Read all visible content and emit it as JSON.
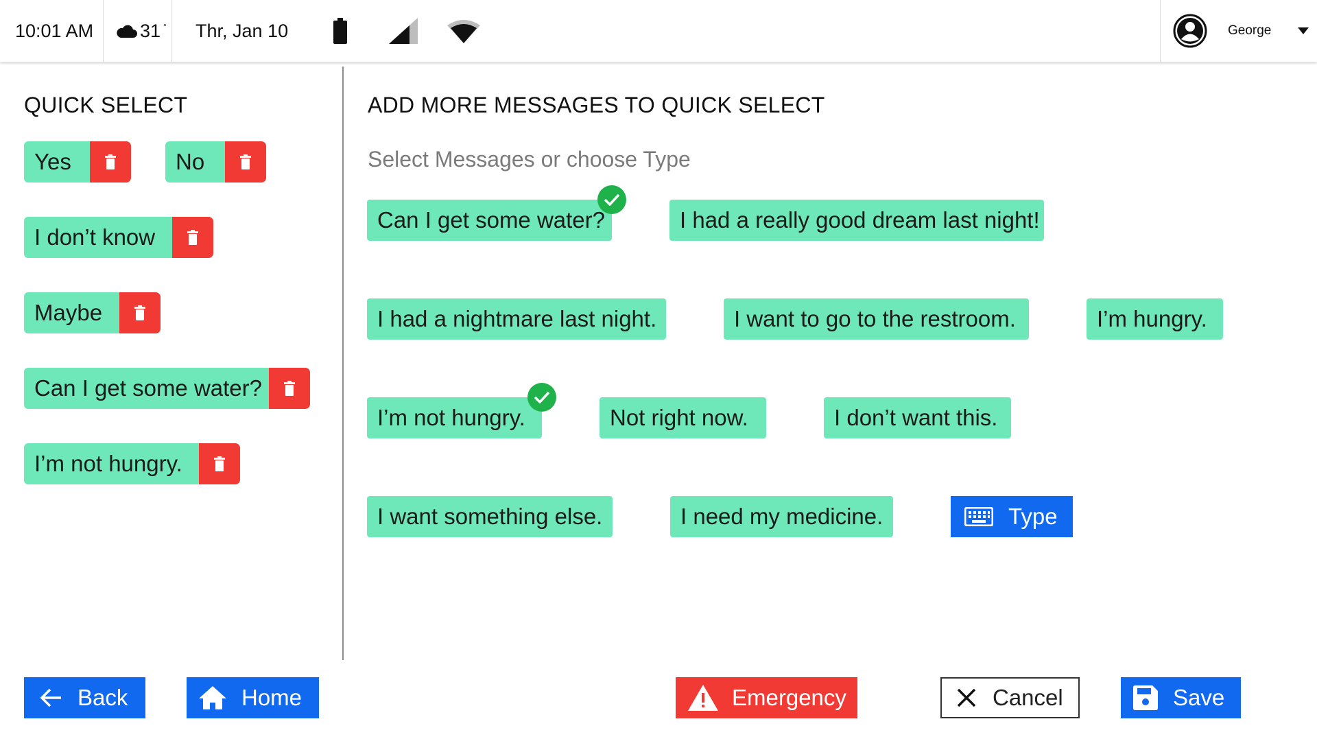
{
  "status_bar": {
    "time": "10:01 AM",
    "temperature": "31",
    "degree_symbol": "°",
    "date": "Thr, Jan 10",
    "weather_icon": "cloud-icon",
    "battery_icon": "battery-icon",
    "signal_icon": "cell-signal-icon",
    "wifi_icon": "wifi-icon"
  },
  "user": {
    "name": "George",
    "avatar_icon": "user-circle-icon",
    "menu_icon": "caret-down-icon"
  },
  "quick_select": {
    "title": "QUICK SELECT",
    "items": [
      {
        "label": "Yes"
      },
      {
        "label": "No"
      },
      {
        "label": "I don’t know"
      },
      {
        "label": "Maybe"
      },
      {
        "label": "Can I get some water?"
      },
      {
        "label": "I’m not hungry."
      }
    ]
  },
  "add_more": {
    "title": "ADD MORE MESSAGES TO QUICK SELECT",
    "subtitle": "Select Messages or choose Type",
    "messages": [
      {
        "label": "Can I get some water?",
        "selected": true
      },
      {
        "label": "I had a really good dream last night!",
        "selected": false
      },
      {
        "label": "I had a nightmare last night.",
        "selected": false
      },
      {
        "label": "I want to go to the restroom.",
        "selected": false
      },
      {
        "label": "I’m hungry.",
        "selected": false
      },
      {
        "label": "I’m not hungry.",
        "selected": true
      },
      {
        "label": "Not right now.",
        "selected": false
      },
      {
        "label": "I don’t want this.",
        "selected": false
      },
      {
        "label": "I want something else.",
        "selected": false
      },
      {
        "label": "I need my medicine.",
        "selected": false
      }
    ],
    "type_button": {
      "label": "Type",
      "icon": "keyboard-icon"
    }
  },
  "bottom_bar": {
    "back": "Back",
    "home": "Home",
    "emergency": "Emergency",
    "cancel": "Cancel",
    "save": "Save"
  },
  "colors": {
    "pill": "#6ee8b8",
    "delete": "#f03a33",
    "primary": "#1169f0",
    "check": "#1fb24a"
  }
}
